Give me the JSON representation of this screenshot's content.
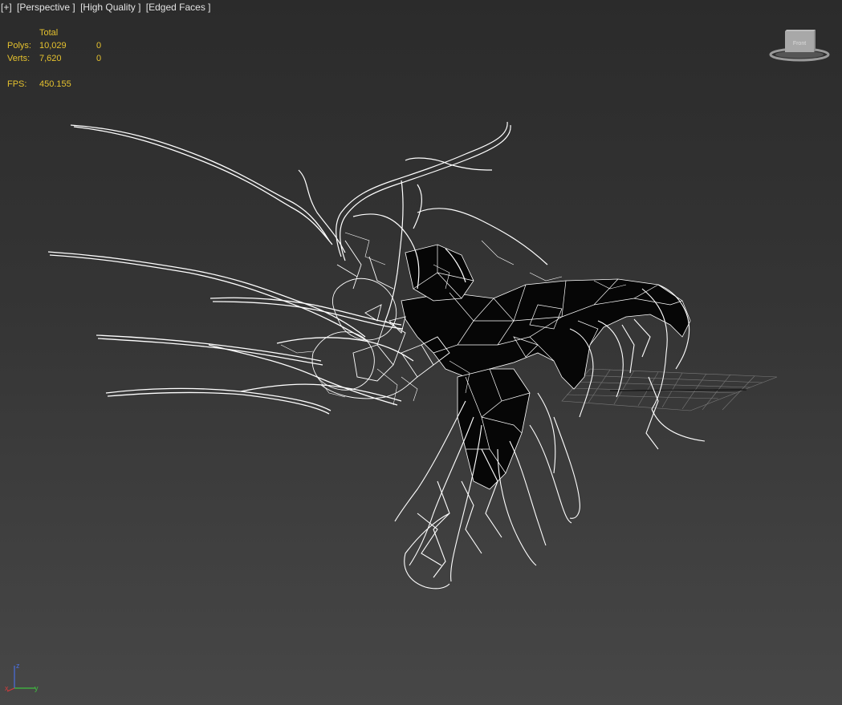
{
  "viewport": {
    "labels": [
      "[+]",
      "[Perspective ]",
      "[High Quality ]",
      "[Edged Faces ]"
    ]
  },
  "stats": {
    "header": "Total",
    "rows": [
      {
        "label": "Polys:",
        "total": "10,029",
        "selected": "0"
      },
      {
        "label": "Verts:",
        "total": "7,620",
        "selected": "0"
      }
    ],
    "fps_label": "FPS:",
    "fps_value": "450.155"
  },
  "viewcube": {
    "face_label": "Front",
    "icon": "viewcube-icon"
  },
  "axis_tripod": {
    "x_label": "x",
    "y_label": "y",
    "z_label": "z",
    "colors": {
      "x": "#d23b3b",
      "y": "#3fbf3f",
      "z": "#4a6fe0"
    }
  },
  "colors": {
    "wire": "#ffffff",
    "stats_text": "#e6c22e",
    "grid": "#8a8a8a"
  }
}
